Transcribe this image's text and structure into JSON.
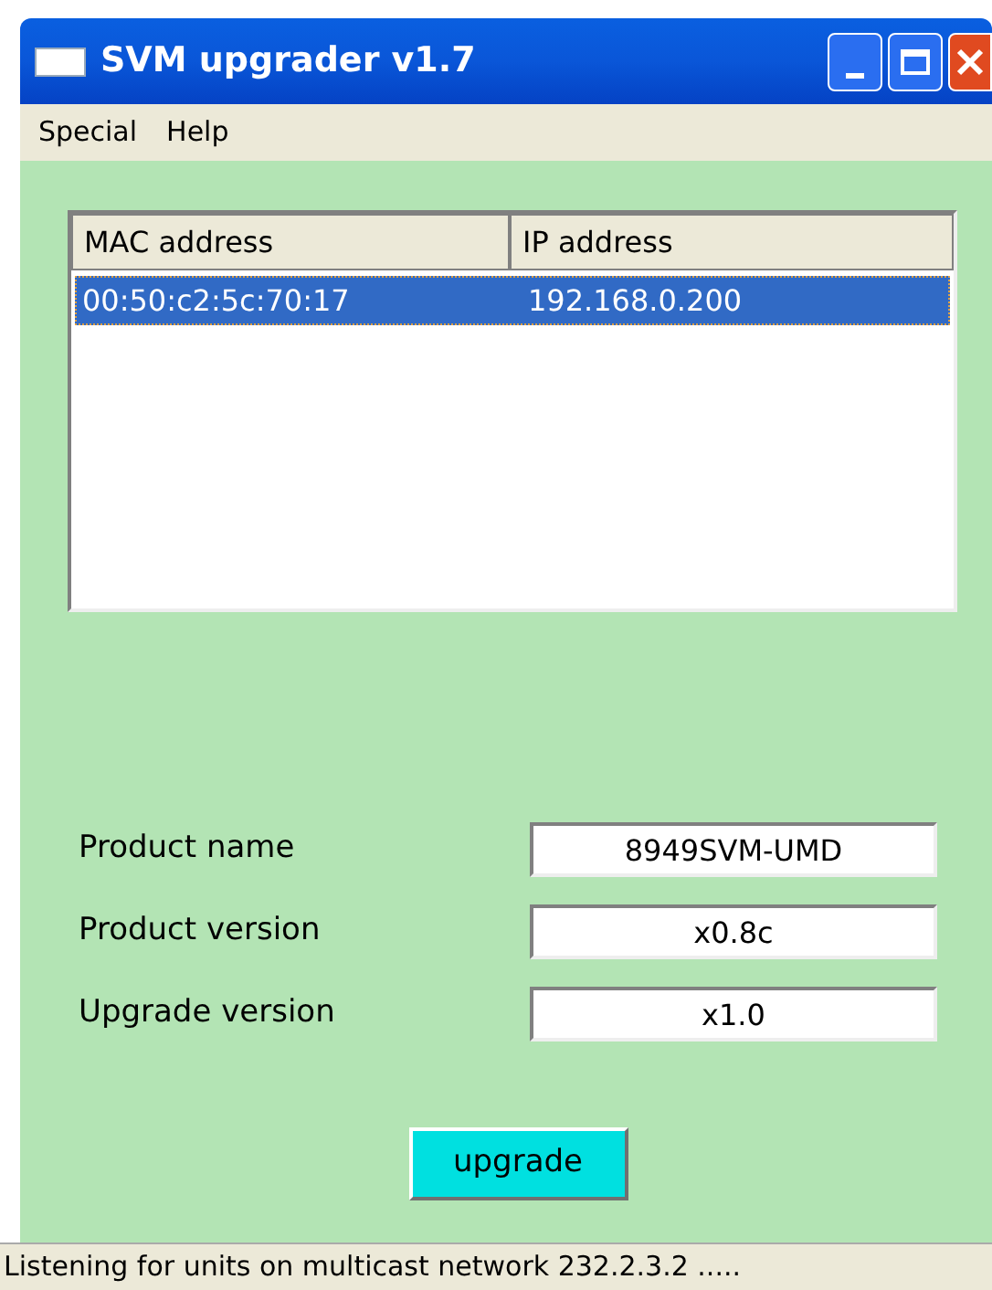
{
  "window": {
    "title": "SVM upgrader v1.7"
  },
  "menu": [
    "Special",
    "Help"
  ],
  "table": {
    "columns": [
      "MAC address",
      "IP address"
    ],
    "rows": [
      {
        "cells": [
          "00:50:c2:5c:70:17",
          "192.168.0.200"
        ],
        "selected": true
      }
    ]
  },
  "fields": [
    {
      "label": "Product name",
      "value": "8949SVM-UMD"
    },
    {
      "label": "Product version",
      "value": "x0.8c"
    },
    {
      "label": "Upgrade version",
      "value": "x1.0"
    }
  ],
  "button": "upgrade",
  "status_bar": "Listening for units on multicast network 232.2.3.2 ....."
}
